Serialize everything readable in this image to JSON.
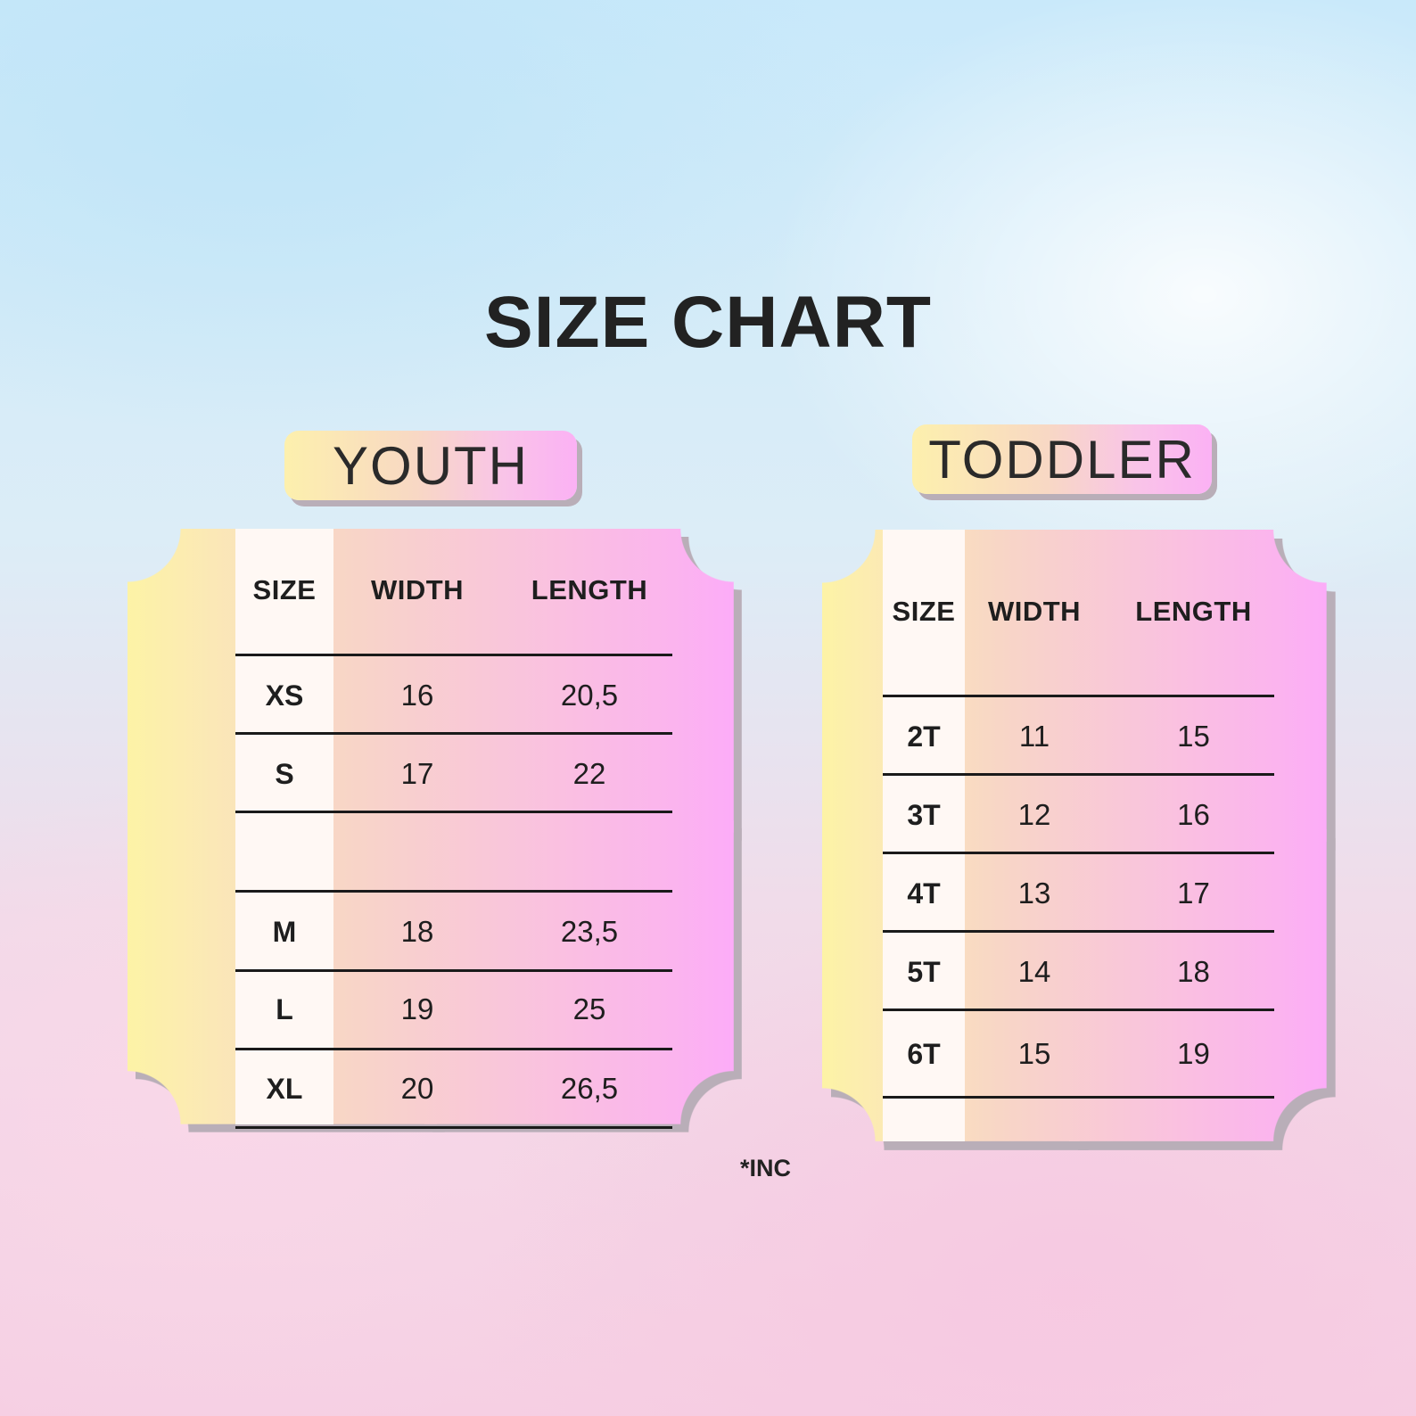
{
  "title": "SIZE CHART",
  "youth": {
    "label": "YOUTH",
    "headers": [
      "SIZE",
      "WIDTH",
      "LENGTH"
    ],
    "rows": [
      [
        "XS",
        "16",
        "20,5"
      ],
      [
        "S",
        "17",
        "22"
      ],
      [
        "",
        "",
        ""
      ],
      [
        "M",
        "18",
        "23,5"
      ],
      [
        "L",
        "19",
        "25"
      ],
      [
        "XL",
        "20",
        "26,5"
      ]
    ]
  },
  "toddler": {
    "label": "TODDLER",
    "headers": [
      "SIZE",
      "WIDTH",
      "LENGTH"
    ],
    "rows": [
      [
        "2T",
        "11",
        "15"
      ],
      [
        "3T",
        "12",
        "16"
      ],
      [
        "4T",
        "13",
        "17"
      ],
      [
        "5T",
        "14",
        "18"
      ],
      [
        "6T",
        "15",
        "19"
      ]
    ]
  },
  "note": "*INC",
  "colors": {
    "ticket_left": "#fdf3a6",
    "ticket_right": "#fcacf8",
    "size_column": "#fff8f4",
    "shadow": "#b9aeb8",
    "text": "#1e1e1e"
  }
}
